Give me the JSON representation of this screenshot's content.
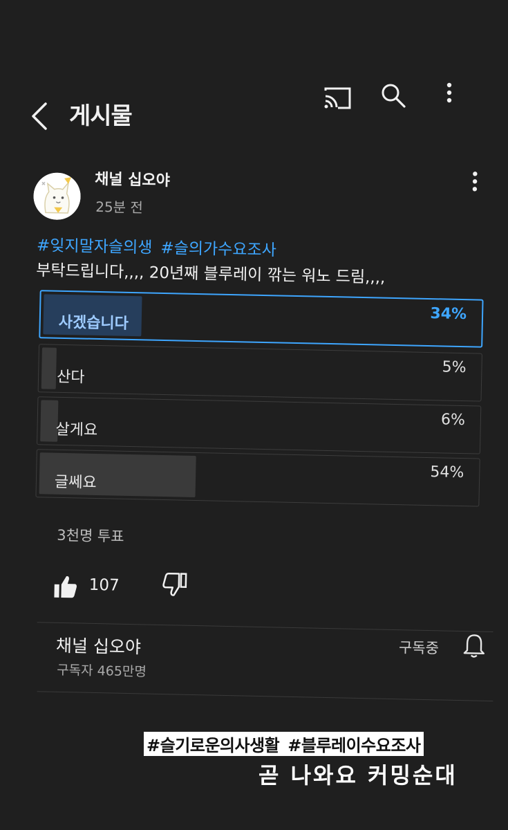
{
  "header": {
    "title": "게시물"
  },
  "post": {
    "channel_name": "채널 십오야",
    "time": "25분 전",
    "hashtags": [
      "#잊지말자슬의생",
      "#슬의가수요조사"
    ],
    "body": "부탁드립니다,,,, 20년째 블루레이 깎는 워노 드림,,,,",
    "poll": {
      "options": [
        {
          "label": "사겠습니다",
          "percent_text": "34%",
          "percent": 34,
          "selected": true
        },
        {
          "label": "산다",
          "percent_text": "5%",
          "percent": 5,
          "selected": false
        },
        {
          "label": "살게요",
          "percent_text": "6%",
          "percent": 6,
          "selected": false
        },
        {
          "label": "글쎄요",
          "percent_text": "54%",
          "percent": 54,
          "selected": false
        }
      ],
      "votes": "3천명 투표"
    },
    "likes": "107"
  },
  "subscription": {
    "channel_name": "채널 십오야",
    "subscribers": "구독자 465만명",
    "status": "구독중"
  },
  "caption": {
    "hashtags": [
      "#슬기로운의사생활",
      "#블루레이수요조사"
    ],
    "text": "곧 나와요 커밍순대"
  },
  "colors": {
    "background": "#1f1f1f",
    "accent": "#3ea6ff",
    "selected_fill": "#263e5c"
  }
}
